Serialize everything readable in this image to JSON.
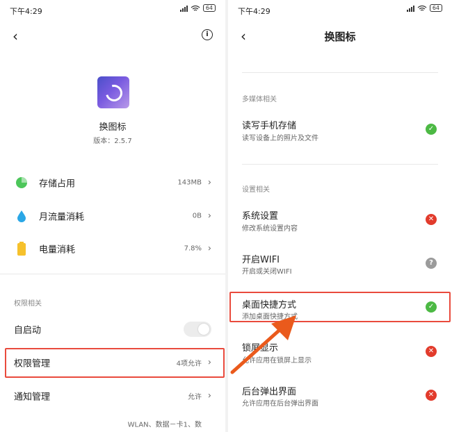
{
  "colors": {
    "highlight": "#e94a3c",
    "ok": "#4cb944",
    "deny": "#e23b2c",
    "unknown": "#9b9b9b",
    "storage_icon": "#4cc65a",
    "data_icon": "#2aa7e6",
    "battery_icon": "#f6c12c"
  },
  "left": {
    "status": {
      "time": "下午4:29",
      "battery": "64"
    },
    "app": {
      "name": "换图标",
      "version": "版本：2.5.7"
    },
    "usage": [
      {
        "label": "存储占用",
        "value": "143MB",
        "icon": "pie-chart-icon"
      },
      {
        "label": "月流量消耗",
        "value": "0B",
        "icon": "water-drop-icon"
      },
      {
        "label": "电量消耗",
        "value": "7.8%",
        "icon": "battery-icon"
      }
    ],
    "permissions_header": "权限相关",
    "autostart": {
      "label": "自启动",
      "enabled": false
    },
    "perm_manage": {
      "label": "权限管理",
      "value": "4项允许"
    },
    "notify": {
      "label": "通知管理",
      "value": "允许"
    },
    "partial": {
      "value": "WLAN、数据－卡1、数"
    }
  },
  "right": {
    "status": {
      "time": "下午4:29",
      "battery": "64"
    },
    "title": "换图标",
    "section_media": "多媒体相关",
    "storage": {
      "title": "读写手机存储",
      "desc": "读写设备上的照片及文件",
      "state": "allowed"
    },
    "section_settings": "设置相关",
    "sys": {
      "title": "系统设置",
      "desc": "修改系统设置内容",
      "state": "denied"
    },
    "wifi": {
      "title": "开启WIFI",
      "desc": "开启或关闭WIFI",
      "state": "ask"
    },
    "shortcut": {
      "title": "桌面快捷方式",
      "desc": "添加桌面快捷方式",
      "state": "allowed"
    },
    "lock": {
      "title": "锁屏显示",
      "desc": "允许应用在锁屏上显示",
      "state": "denied"
    },
    "popup": {
      "title": "后台弹出界面",
      "desc": "允许应用在后台弹出界面",
      "state": "denied"
    }
  }
}
